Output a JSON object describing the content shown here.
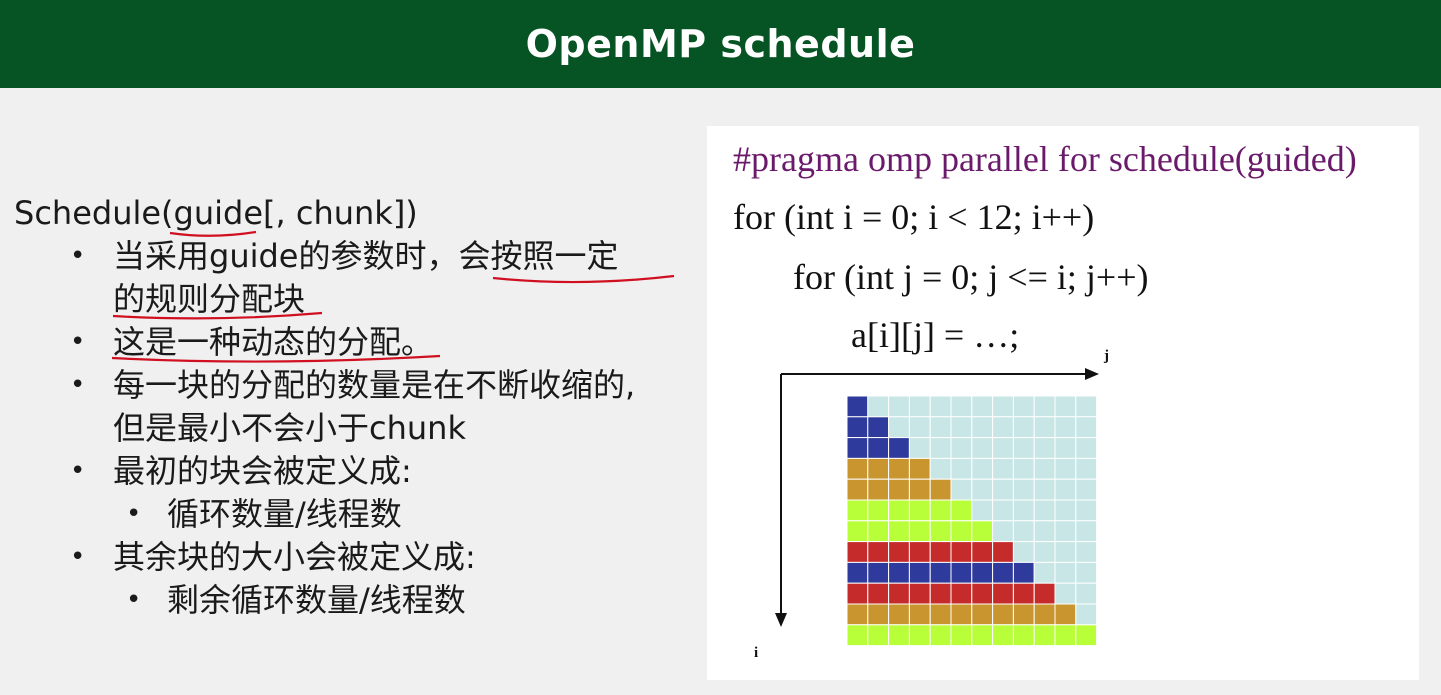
{
  "header": {
    "title": "OpenMP schedule"
  },
  "content": {
    "heading": "Schedule(guide[, chunk])",
    "bullets": [
      {
        "line1": "当采用guide的参数时，会按照一定",
        "line2": "的规则分配块"
      },
      {
        "text": "这是一种动态的分配。"
      },
      {
        "line1": "每一块的分配的数量是在不断收缩的,",
        "line2": "但是最小不会小于chunk"
      },
      {
        "text": "最初的块会被定义成:",
        "sub": "循环数量/线程数"
      },
      {
        "text": "其余块的大小会被定义成:",
        "sub": "剩余循环数量/线程数"
      }
    ]
  },
  "figure": {
    "pragma": "#pragma omp parallel for schedule(guided)",
    "code_line1": "for (int i = 0; i < 12; i++)",
    "code_line2": "for (int j = 0; j <= i; j++)",
    "code_line3": "a[i][j] = …;",
    "axis_j": "j",
    "axis_i": "i",
    "grid": {
      "rows": 12,
      "cols": 12,
      "background_color": "#c8e6e6",
      "row_colors": [
        "#2e3a9c",
        "#2e3a9c",
        "#2e3a9c",
        "#c8952e",
        "#c8952e",
        "#b8ff3a",
        "#b8ff3a",
        "#c62b2b",
        "#2e3a9c",
        "#c62b2b",
        "#c8952e",
        "#b8ff3a"
      ],
      "filled_per_row": [
        1,
        2,
        3,
        4,
        5,
        6,
        7,
        8,
        9,
        10,
        11,
        12
      ]
    }
  },
  "colors": {
    "header_bg": "#065424",
    "underline": "#d01020"
  }
}
